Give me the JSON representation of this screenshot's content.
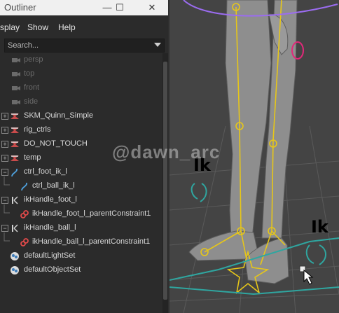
{
  "window": {
    "title": "Outliner",
    "minimize_label": "—",
    "maximize_label": "☐",
    "close_label": "✕"
  },
  "menu": {
    "display": "splay",
    "show": "Show",
    "help": "Help"
  },
  "search": {
    "placeholder": "Search..."
  },
  "items": [
    {
      "label": "persp",
      "icon": "camera-icon",
      "dim": true
    },
    {
      "label": "top",
      "icon": "camera-icon",
      "dim": true
    },
    {
      "label": "front",
      "icon": "camera-icon",
      "dim": true
    },
    {
      "label": "side",
      "icon": "camera-icon",
      "dim": true
    },
    {
      "label": "SKM_Quinn_Simple",
      "icon": "group-icon",
      "expandable": true
    },
    {
      "label": "rig_ctrls",
      "icon": "group-icon",
      "expandable": true
    },
    {
      "label": "DO_NOT_TOUCH",
      "icon": "group-icon",
      "expandable": true
    },
    {
      "label": "temp",
      "icon": "group-icon",
      "expandable": true
    },
    {
      "label": "ctrl_foot_ik_l",
      "icon": "curve-icon",
      "expandable": true
    },
    {
      "label": "ctrl_ball_ik_l",
      "icon": "curve-icon"
    },
    {
      "label": "ikHandle_foot_l",
      "icon": "ik-handle-icon",
      "expandable": true
    },
    {
      "label": "ikHandle_foot_l_parentConstraint1",
      "icon": "constraint-icon"
    },
    {
      "label": "ikHandle_ball_l",
      "icon": "ik-handle-icon",
      "expandable": true
    },
    {
      "label": "ikHandle_ball_l_parentConstraint1",
      "icon": "constraint-icon"
    },
    {
      "label": "defaultLightSet",
      "icon": "set-icon"
    },
    {
      "label": "defaultObjectSet",
      "icon": "set-icon"
    }
  ],
  "viewport": {
    "watermark": "@dawn_arc",
    "ik_label_1": "Ik",
    "ik_label_2": "Ik"
  },
  "colors": {
    "joint": "#e6c619",
    "control_teal": "#2fa6a0",
    "control_purple": "#9b6cf0",
    "control_pink": "#e2287a"
  }
}
